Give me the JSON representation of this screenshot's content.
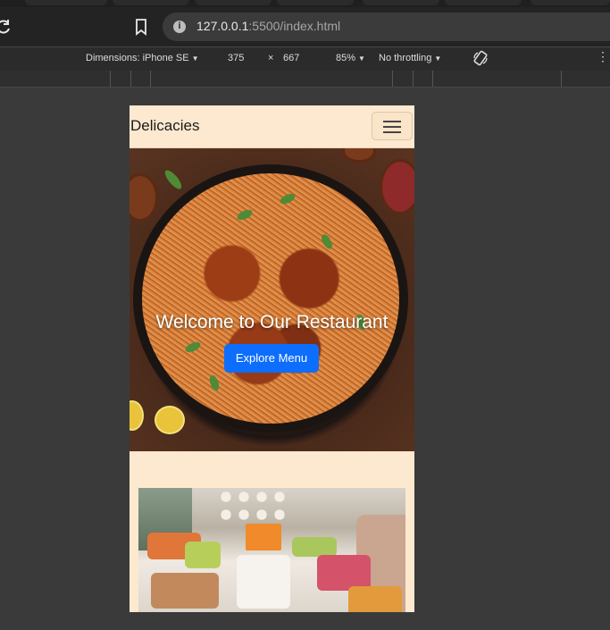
{
  "browser": {
    "url_host": "127.0.0.1",
    "url_rest": ":5500/index.html"
  },
  "device_toolbar": {
    "dimensions_label": "Dimensions: iPhone SE",
    "width": "375",
    "times": "×",
    "height": "667",
    "zoom": "85%",
    "throttling": "No throttling"
  },
  "site": {
    "brand": "Delicacies",
    "hero_title": "Welcome to Our Restaurant",
    "hero_button": "Explore Menu"
  },
  "icons": {
    "reload": "reload-icon",
    "bookmark": "bookmark-icon",
    "info": "info-icon",
    "rotate": "rotate-icon",
    "more": "more-icon",
    "menu": "hamburger-menu-icon"
  },
  "colors": {
    "page_bg": "#fde9cf",
    "primary_button": "#0d6efd"
  }
}
